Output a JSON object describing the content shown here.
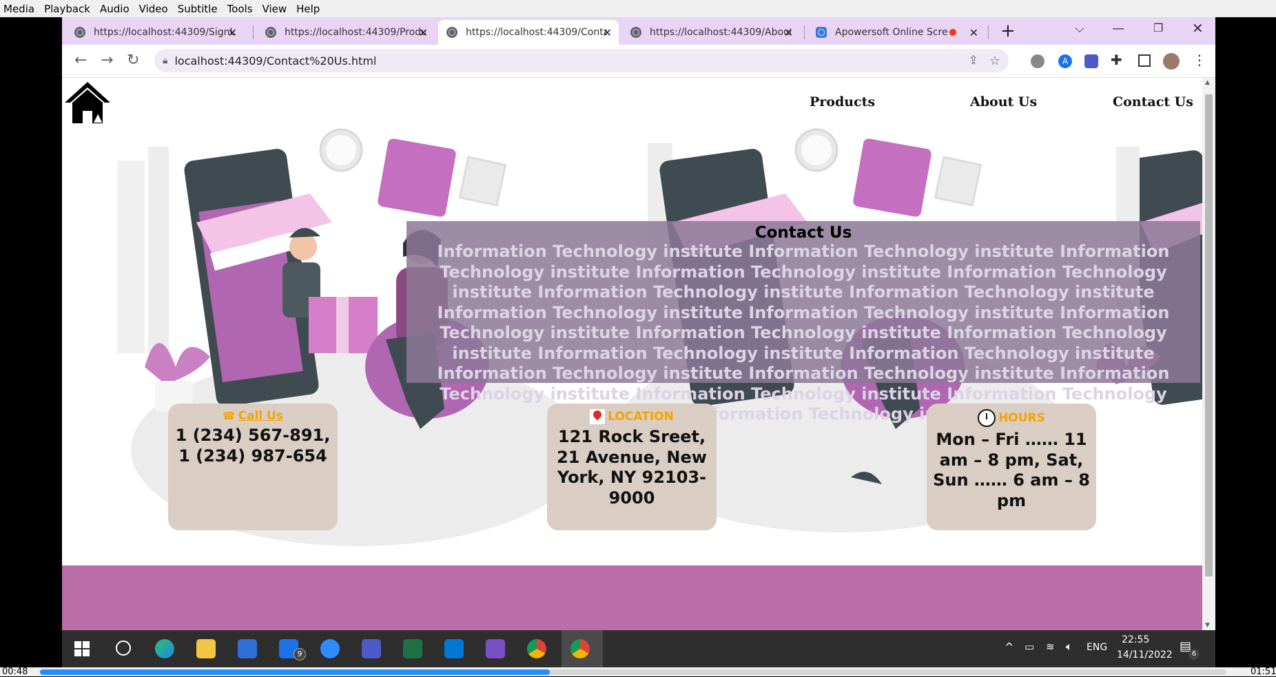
{
  "vlc": {
    "menu": [
      "Media",
      "Playback",
      "Audio",
      "Video",
      "Subtitle",
      "Tools",
      "View",
      "Help"
    ],
    "time_current": "00:48",
    "time_total": "01:51",
    "progress_fraction": 0.43
  },
  "browser": {
    "tabs": [
      {
        "title": "https://localhost:44309/SignU"
      },
      {
        "title": "https://localhost:44309/Produ"
      },
      {
        "title": "https://localhost:44309/Conta"
      },
      {
        "title": "https://localhost:44309/About"
      },
      {
        "title": "Apowersoft Online Scree"
      }
    ],
    "active_tab": 2,
    "new_tab_label": "+",
    "url": "localhost:44309/Contact%20Us.html"
  },
  "page": {
    "nav": {
      "products": "Products",
      "about": "About Us",
      "contact": "Contact Us"
    },
    "contact_title": "Contact Us",
    "contact_body": "Information Technology institute Information Technology institute Information Technology institute Information Technology institute Information Technology institute Information Technology institute Information Technology institute Information Technology institute Information Technology institute Information Technology institute Information Technology institute Information Technology institute Information Technology institute Information Technology institute Information Technology institute Information Technology institute Information Technology institute Information Technology institute Information Technology institute Information Technology institute",
    "cards": {
      "call": {
        "heading": "Call Us",
        "body": "1 (234) 567-891, 1 (234) 987-654"
      },
      "location": {
        "heading": "LOCATION",
        "body": "121 Rock Sreet, 21 Avenue, New York, NY 92103-9000"
      },
      "hours": {
        "heading": "HOURS",
        "body": "Mon – Fri …… 11 am – 8 pm, Sat, Sun …… 6 am – 8 pm"
      }
    },
    "colors": {
      "footer": "#b96ea8",
      "accent_heading": "#f5a300",
      "card_bg": "#d9cdc4"
    }
  },
  "taskbar": {
    "mail_badge": "9",
    "language": "ENG",
    "clock_time": "22:55",
    "clock_date": "14/11/2022",
    "notification_count": "6"
  }
}
